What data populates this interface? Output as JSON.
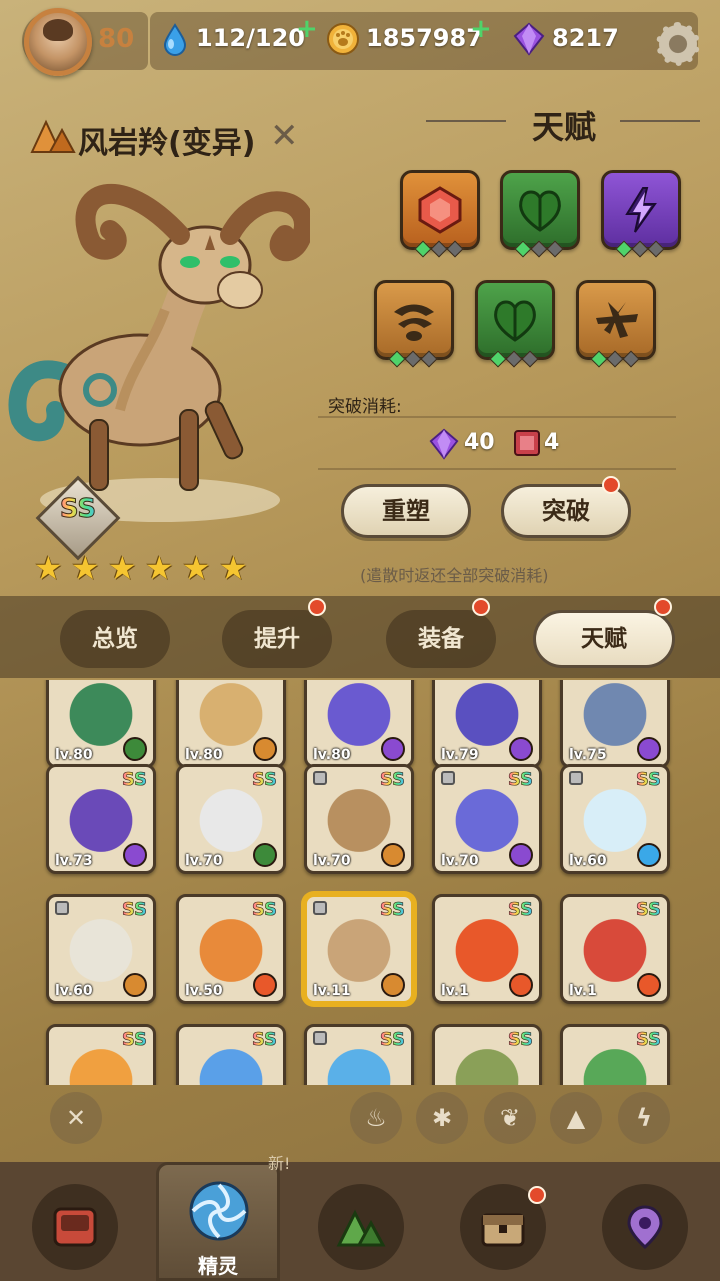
{
  "player": {
    "level": "80",
    "energy": "112/120",
    "coins": "1857987",
    "gems": "8217"
  },
  "pet": {
    "name": "风岩羚(变异)",
    "rank": "SS",
    "stars": 6
  },
  "talent": {
    "title": "天赋",
    "icons": [
      "heart-gem-icon",
      "leaf-heart-icon",
      "lightning-icon",
      "sand-swirl-icon",
      "leaf-heart-icon",
      "cross-slash-icon"
    ],
    "breakthrough_label": "突破消耗:",
    "cost_gem": "40",
    "cost_book": "4",
    "reshape_label": "重塑",
    "breakthrough_button": "突破",
    "note": "(遣散时返还全部突破消耗)"
  },
  "tabs": [
    "总览",
    "提升",
    "装备",
    "天赋"
  ],
  "roster": [
    {
      "lv": "lv.80",
      "el": "leaf"
    },
    {
      "lv": "lv.80",
      "el": "earth"
    },
    {
      "lv": "lv.80",
      "el": "thunder"
    },
    {
      "lv": "lv.79",
      "el": "thunder"
    },
    {
      "lv": "lv.75",
      "el": "thunder"
    },
    {
      "lv": "lv.73",
      "el": "thunder",
      "ss": "SS"
    },
    {
      "lv": "lv.70",
      "el": "leaf",
      "ss": "SS"
    },
    {
      "lv": "lv.70",
      "el": "earth",
      "ss": "SS"
    },
    {
      "lv": "lv.70",
      "el": "thunder",
      "ss": "SS"
    },
    {
      "lv": "lv.60",
      "el": "ice",
      "ss": "SS"
    },
    {
      "lv": "lv.60",
      "el": "earth",
      "ss": "SS"
    },
    {
      "lv": "lv.50",
      "el": "fire",
      "ss": "SS"
    },
    {
      "lv": "lv.11",
      "el": "earth",
      "ss": "SS"
    },
    {
      "lv": "lv.1",
      "el": "fire",
      "ss": "SS"
    },
    {
      "lv": "lv.1",
      "el": "fire",
      "ss": "SS"
    },
    {
      "lv": "",
      "el": "",
      "ss": "SS"
    },
    {
      "lv": "",
      "el": "",
      "ss": "SS"
    },
    {
      "lv": "",
      "el": "",
      "ss": "SS"
    },
    {
      "lv": "",
      "el": "",
      "ss": "SS"
    },
    {
      "lv": "",
      "el": "",
      "ss": "SS"
    }
  ],
  "nav": {
    "spirit_label": "精灵",
    "hint": "新!"
  }
}
